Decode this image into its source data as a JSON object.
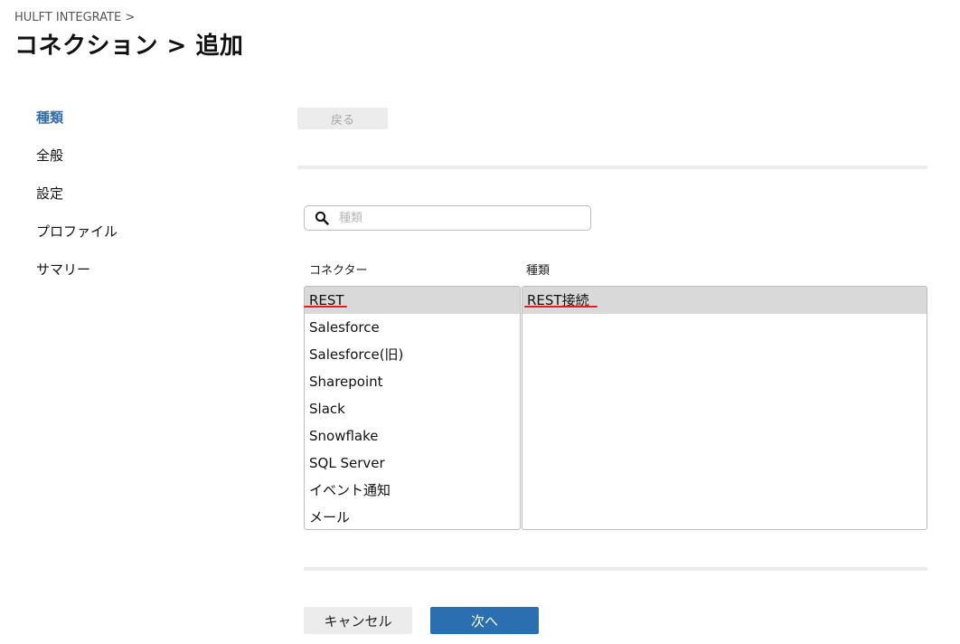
{
  "header": {
    "breadcrumb": "HULFT INTEGRATE >",
    "title": "コネクション > 追加"
  },
  "steps": [
    {
      "label": "種類",
      "active": true
    },
    {
      "label": "全般",
      "active": false
    },
    {
      "label": "設定",
      "active": false
    },
    {
      "label": "プロファイル",
      "active": false
    },
    {
      "label": "サマリー",
      "active": false
    }
  ],
  "toolbar": {
    "back_label": "戻る"
  },
  "search": {
    "placeholder": "種類",
    "value": "",
    "icon": "search-icon"
  },
  "columns": {
    "connector_header": "コネクター",
    "type_header": "種類"
  },
  "connectors": [
    "REST",
    "Salesforce",
    "Salesforce(旧)",
    "Sharepoint",
    "Slack",
    "Snowflake",
    "SQL Server",
    "イベント通知",
    "メール"
  ],
  "selected_connector": "REST",
  "types": [
    "REST接続"
  ],
  "selected_type": "REST接続",
  "footer": {
    "cancel_label": "キャンセル",
    "next_label": "次へ"
  },
  "colors": {
    "accent": "#2b6fb0",
    "selection": "#d9d9d9",
    "annotation": "#e02020"
  }
}
